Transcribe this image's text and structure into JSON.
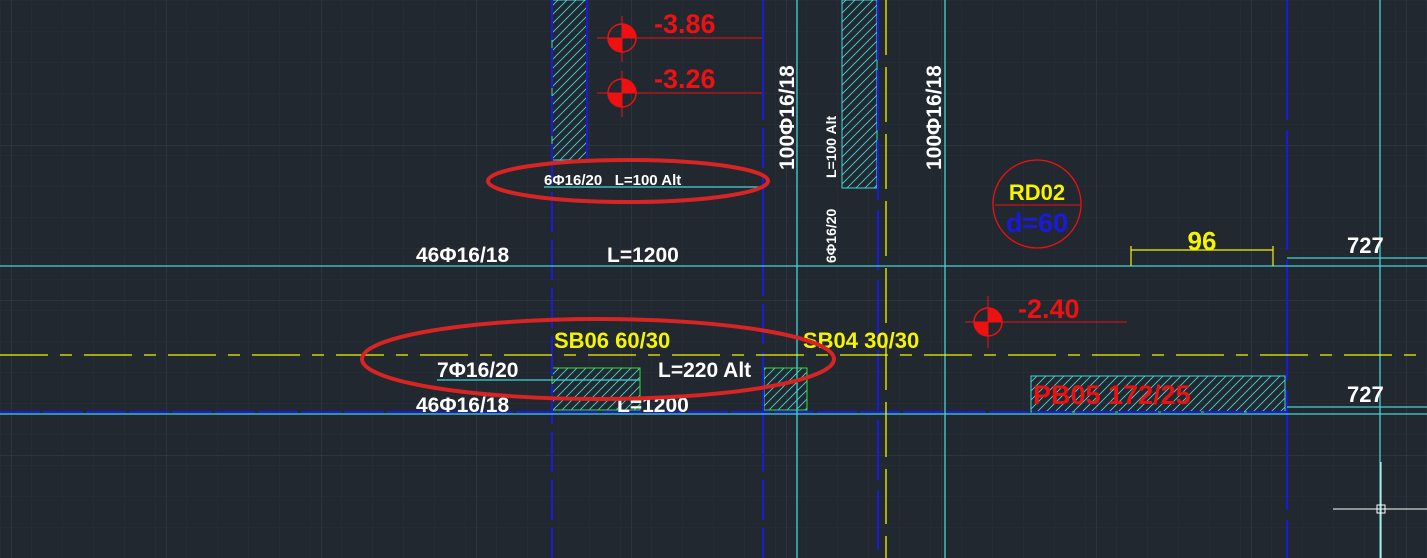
{
  "colors": {
    "background": "#212830",
    "grid_minor": "#2b323b",
    "grid_major": "#353d47",
    "cyan": "#45d3d3",
    "blue": "#1a1adc",
    "yellow": "#f5f500",
    "red": "#ee1111",
    "white": "#ffffff",
    "green": "#33dd33",
    "highlight_ellipse": "#d92424"
  },
  "elevations": {
    "top_1": "-3.86",
    "top_2": "-3.26",
    "mid": "-2.40"
  },
  "rebar_labels": {
    "vertical_left": "100Φ16/18",
    "vertical_right": "100Φ16/18",
    "vertical_small": "L=100 Alt",
    "vertical_small_bottom": "6Φ16/20",
    "circled_upper": "6Φ16/20   L=100 Alt",
    "row_upper_left": "46Φ16/18",
    "row_upper_right": "L=1200",
    "row_mid_left": "7Φ16/20",
    "row_mid_right": "L=220 Alt",
    "row_lower_left": "46Φ16/18",
    "row_lower_right": "L=1200"
  },
  "beams": {
    "sb06": "SB06 60/30",
    "sb04": "SB04 30/30",
    "pb05": "PB05 172/25"
  },
  "pile": {
    "name": "RD02",
    "diameter": "d=60"
  },
  "dimensions": {
    "span": "96",
    "level_upper": "727",
    "level_lower": "727"
  }
}
